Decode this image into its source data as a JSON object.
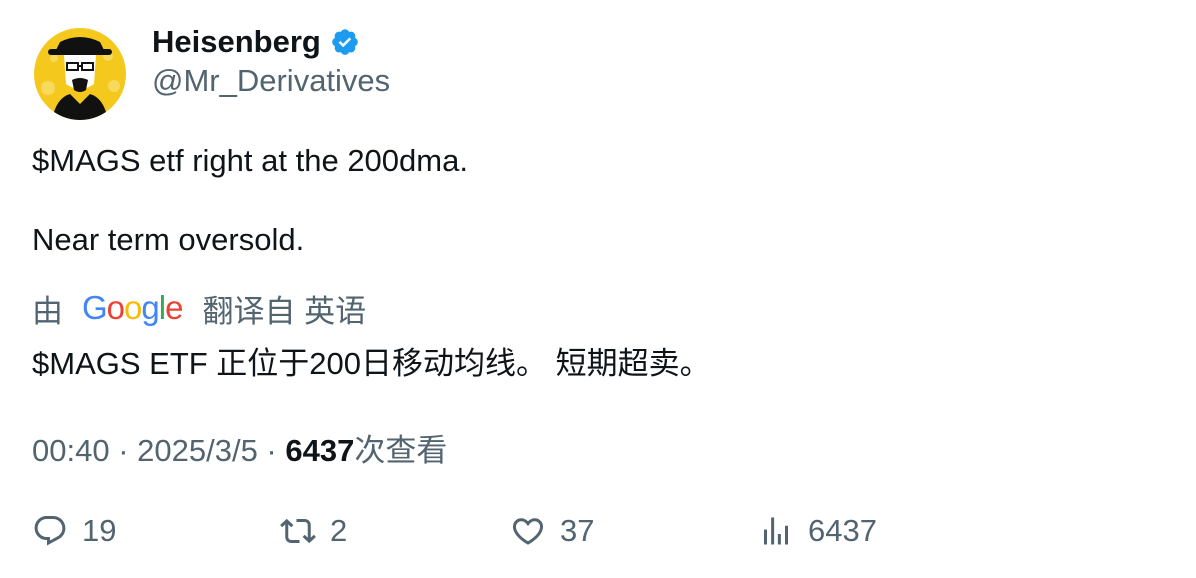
{
  "author": {
    "name": "Heisenberg",
    "handle": "@Mr_Derivatives",
    "avatar_icon": "heisenberg-portrait-avatar",
    "verified_icon": "verified-badge-icon",
    "verified_color": "#1d9bf0"
  },
  "tweet": {
    "line1": "$MAGS etf right at the 200dma.",
    "line2": "Near term oversold."
  },
  "translation": {
    "by_label": "由",
    "provider": "Google",
    "action_label": "翻译自 英语",
    "text": "$MAGS ETF 正位于200日移动均线。 短期超卖。"
  },
  "meta": {
    "time": "00:40",
    "separator": " · ",
    "date": "2025/3/5",
    "views_count": "6437",
    "views_label": "次查看"
  },
  "actions": {
    "replies": "19",
    "retweets": "2",
    "likes": "37",
    "views": "6437"
  },
  "colors": {
    "text_primary": "#0f1419",
    "text_secondary": "#536471",
    "avatar_background": "#f5c81e"
  }
}
